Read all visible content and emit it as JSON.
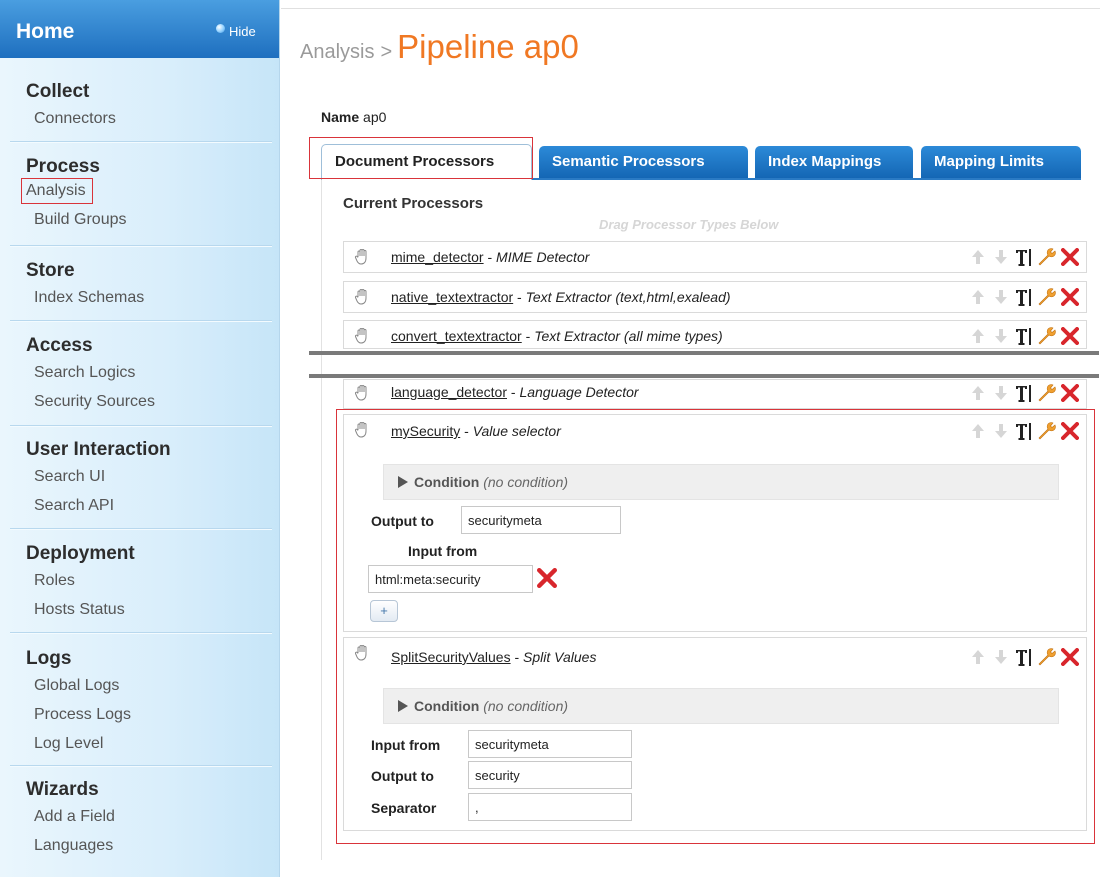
{
  "sidebar": {
    "home": "Home",
    "hide": "Hide",
    "sections": [
      {
        "title": "Collect",
        "items": [
          "Connectors"
        ]
      },
      {
        "title": "Process",
        "items": [
          "Analysis",
          "Build Groups"
        ]
      },
      {
        "title": "Store",
        "items": [
          "Index Schemas"
        ]
      },
      {
        "title": "Access",
        "items": [
          "Search Logics",
          "Security Sources"
        ]
      },
      {
        "title": "User Interaction",
        "items": [
          "Search UI",
          "Search API"
        ]
      },
      {
        "title": "Deployment",
        "items": [
          "Roles",
          "Hosts Status"
        ]
      },
      {
        "title": "Logs",
        "items": [
          "Global Logs",
          "Process Logs",
          "Log Level"
        ]
      },
      {
        "title": "Wizards",
        "items": [
          "Add a Field",
          "Languages"
        ]
      }
    ],
    "selected_item": "Analysis"
  },
  "breadcrumb": {
    "parent": "Analysis",
    "separator": ">",
    "current": "Pipeline ap0"
  },
  "name_field": {
    "label": "Name",
    "value": "ap0"
  },
  "tabs": [
    "Document Processors",
    "Semantic Processors",
    "Index Mappings",
    "Mapping Limits"
  ],
  "active_tab": "Document Processors",
  "processors_panel": {
    "title": "Current Processors",
    "drag_hint": "Drag Processor Types Below",
    "processors": [
      {
        "name": "mime_detector",
        "type": "MIME Detector"
      },
      {
        "name": "native_textextractor",
        "type": "Text Extractor (text,html,exalead)"
      },
      {
        "name": "convert_textextractor",
        "type": "Text Extractor (all mime types)"
      },
      {
        "name": "language_detector",
        "type": "Language Detector"
      },
      {
        "name": "mySecurity",
        "type": "Value selector"
      },
      {
        "name": "SplitSecurityValues",
        "type": "Split Values"
      }
    ],
    "dash": " - "
  },
  "my_security": {
    "condition_label": "Condition",
    "condition_note": "(no condition)",
    "output_label": "Output to",
    "output_value": "securitymeta",
    "input_label": "Input from",
    "input_value": "html:meta:security",
    "add_label": "+"
  },
  "split_values": {
    "condition_label": "Condition",
    "condition_note": "(no condition)",
    "input_label": "Input from",
    "input_value": "securitymeta",
    "output_label": "Output to",
    "output_value": "security",
    "separator_label": "Separator",
    "separator_value": ","
  },
  "colors": {
    "accent_orange": "#f07823",
    "tab_blue": "#1e74c4",
    "delete_red": "#d8262c",
    "wrench_orange": "#f0a030",
    "highlight_red": "#d9343a"
  },
  "icons": [
    "hand-grip-icon",
    "arrow-up-icon",
    "arrow-down-icon",
    "text-cursor-icon",
    "wrench-icon",
    "delete-x-icon",
    "pin-icon",
    "triangle-right-icon"
  ]
}
